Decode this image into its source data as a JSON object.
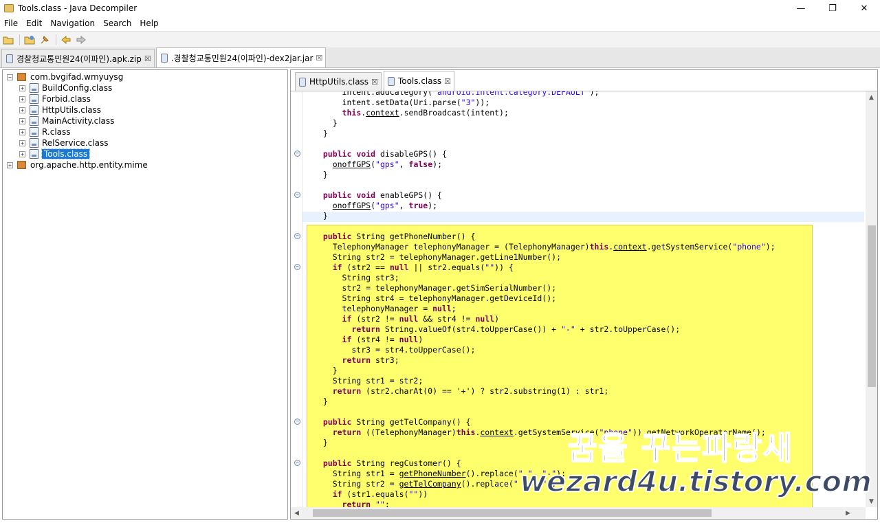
{
  "window": {
    "title": "Tools.class - Java Decompiler",
    "minimize": "—",
    "maximize": "❐",
    "close": "✕"
  },
  "menu": [
    "File",
    "Edit",
    "Navigation",
    "Search",
    "Help"
  ],
  "toolbar": {
    "buttons": [
      "open-file-icon",
      "open-type-icon",
      "pin-icon",
      "back-icon",
      "forward-icon"
    ]
  },
  "outer_tabs": [
    {
      "label": "경찰청교통민원24(이파인).apk.zip",
      "close": "☒"
    },
    {
      "label": ".경찰청교통민원24(이파인)-dex2jar.jar",
      "close": "☒"
    }
  ],
  "tree": {
    "root_package": "com.bvgifad.wmyuysg",
    "classes": [
      "BuildConfig.class",
      "Forbid.class",
      "HttpUtils.class",
      "MainActivity.class",
      "R.class",
      "RelService.class",
      "Tools.class"
    ],
    "selected": "Tools.class",
    "other_package": "org.apache.http.entity.mime",
    "expand_open": "−",
    "expand_closed": "+"
  },
  "editor_tabs": [
    {
      "label": "HttpUtils.class",
      "close": "☒"
    },
    {
      "label": "Tools.class",
      "close": "☒"
    }
  ],
  "code_lines": [
    "      intent.addCategory(\"android.intent.category.DEFAULT\");",
    "      intent.setData(Uri.parse(\"3\"));",
    "      this.context.sendBroadcast(intent);",
    "    }",
    "  }",
    "",
    "  public void disableGPS() {",
    "    onoffGPS(\"gps\", false);",
    "  }",
    "",
    "  public void enableGPS() {",
    "    onoffGPS(\"gps\", true);",
    "  }",
    "",
    "  public String getPhoneNumber() {",
    "    TelephonyManager telephonyManager = (TelephonyManager)this.context.getSystemService(\"phone\");",
    "    String str2 = telephonyManager.getLine1Number();",
    "    if (str2 == null || str2.equals(\"\")) {",
    "      String str3;",
    "      str2 = telephonyManager.getSimSerialNumber();",
    "      String str4 = telephonyManager.getDeviceId();",
    "      telephonyManager = null;",
    "      if (str2 != null && str4 != null)",
    "        return String.valueOf(str4.toUpperCase()) + \"-\" + str2.toUpperCase();",
    "      if (str4 != null)",
    "        str3 = str4.toUpperCase();",
    "      return str3;",
    "    }",
    "    String str1 = str2;",
    "    return (str2.charAt(0) == '+') ? str2.substring(1) : str1;",
    "  }",
    "",
    "  public String getTelCompany() {",
    "    return ((TelephonyManager)this.context.getSystemService(\"phone\")).getNetworkOperatorName();",
    "  }",
    "",
    "  public String regCustomer() {",
    "    String str1 = getPhoneNumber().replace(\" \", \"-\");",
    "    String str2 = getTelCompany().replace(\" \", \"\");",
    "    if (str1.equals(\"\"))",
    "      return \"\";"
  ],
  "watermark": {
    "line1": "꿈을 꾸는파랑새",
    "line2": "wezard4u.tistory.com"
  },
  "colors": {
    "highlight": "#ffff6e",
    "keyword": "#7f0055",
    "string": "#2a00ff",
    "selection": "#1879d6"
  }
}
